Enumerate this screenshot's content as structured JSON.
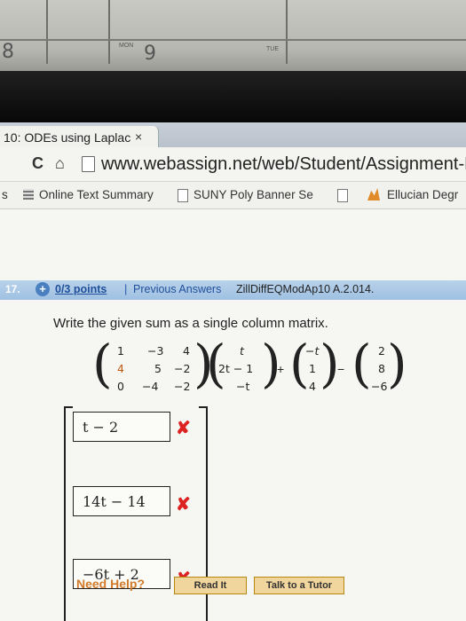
{
  "desk": {
    "cal_left_num": "8",
    "cal_mid_num": "9",
    "cal_small_left": "MON",
    "cal_small_right": "TUE"
  },
  "browser": {
    "tab_title": "10: ODEs using Laplac",
    "tab_close": "×",
    "url": "www.webassign.net/web/Student/Assignment-F",
    "bookmarks": [
      {
        "label": "Online Text Summary"
      },
      {
        "label": "SUNY Poly Banner Se"
      },
      {
        "label": "Ellucian Degr"
      }
    ],
    "bm_left_cut": "s"
  },
  "question": {
    "number": "17.",
    "points": "0/3 points",
    "separator": "|",
    "previous_answers": "Previous Answers",
    "problem_id": "ZillDiffEQModAp10 A.2.014.",
    "prompt": "Write the given sum as a single column matrix.",
    "matrix_a": [
      [
        "1",
        "−3",
        "4"
      ],
      [
        "4",
        "5",
        "−2"
      ],
      [
        "0",
        "−4",
        "−2"
      ]
    ],
    "vector_b": [
      "t",
      "2t − 1",
      "−t"
    ],
    "vector_c": [
      "−t",
      "1",
      "4"
    ],
    "vector_d": [
      "2",
      "8",
      "−6"
    ],
    "plus": "+",
    "minus": "−",
    "answers": [
      "t − 2",
      "14t − 14",
      "−6t + 2"
    ],
    "wrong_mark": "✘",
    "need_help": "Need Help?",
    "read_it": "Read It",
    "talk_tutor": "Talk to a Tutor"
  },
  "colors": {
    "qbar": "#9fc0e2",
    "link": "#1f4f9a",
    "wrong": "#dd2222",
    "help": "#d07a2a"
  }
}
